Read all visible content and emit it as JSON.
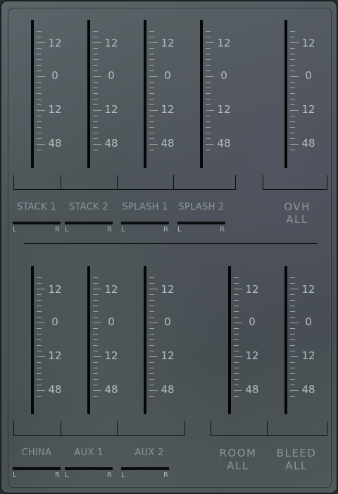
{
  "scale_labels": [
    "12",
    "0",
    "12",
    "48"
  ],
  "top_section": {
    "faders": [
      {
        "id": "stack-1",
        "label": "STACK 1",
        "level": 0.0
      },
      {
        "id": "stack-2",
        "label": "STACK 2",
        "level": 0.0
      },
      {
        "id": "splash-1",
        "label": "SPLASH 1",
        "level": 0.0
      },
      {
        "id": "splash-2",
        "label": "SPLASH 2",
        "level": 0.0
      }
    ],
    "ovh": {
      "label_line1": "OVH",
      "label_line2": "ALL"
    }
  },
  "bottom_section": {
    "faders": [
      {
        "id": "china",
        "label": "CHINA"
      },
      {
        "id": "aux-1",
        "label": "AUX 1"
      },
      {
        "id": "aux-2",
        "label": "AUX 2"
      }
    ],
    "room": {
      "label_line1": "ROOM",
      "label_line2": "ALL"
    },
    "bleed": {
      "label_line1": "BLEED",
      "label_line2": "ALL"
    }
  },
  "meter_labels": {
    "left": "L",
    "right": "R"
  },
  "colors": {
    "panel": "#4b5357",
    "track": "#050607",
    "tick": "#9aa4a8",
    "text": "#b3bcc0",
    "label": "#8a959a"
  }
}
